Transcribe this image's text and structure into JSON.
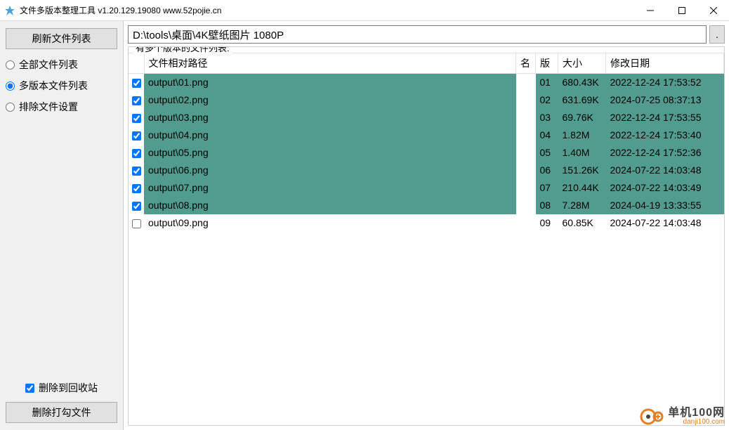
{
  "titlebar": {
    "title": "文件多版本整理工具 v1.20.129.19080 www.52pojie.cn"
  },
  "sidebar": {
    "refresh_label": "刷新文件列表",
    "radios": {
      "all_label": "全部文件列表",
      "multi_label": "多版本文件列表",
      "exclude_label": "排除文件设置"
    },
    "recycle_label": "删除到回收站",
    "delete_label": "删除打勾文件"
  },
  "main": {
    "path_value": "D:\\tools\\桌面\\4K壁纸图片 1080P",
    "path_btn": ".",
    "group_title": "有多个版本的文件列表:",
    "headers": {
      "path": "文件相对路径",
      "name": "名",
      "ver": "版",
      "size": "大小",
      "date": "修改日期"
    },
    "rows": [
      {
        "checked": true,
        "selected": true,
        "path": "output\\01.png",
        "name": "",
        "ver": "01",
        "size": "680.43K",
        "date": "2022-12-24 17:53:52"
      },
      {
        "checked": true,
        "selected": true,
        "path": "output\\02.png",
        "name": "",
        "ver": "02",
        "size": "631.69K",
        "date": "2024-07-25 08:37:13"
      },
      {
        "checked": true,
        "selected": true,
        "path": "output\\03.png",
        "name": "",
        "ver": "03",
        "size": "69.76K",
        "date": "2022-12-24 17:53:55"
      },
      {
        "checked": true,
        "selected": true,
        "path": "output\\04.png",
        "name": "",
        "ver": "04",
        "size": "1.82M",
        "date": "2022-12-24 17:53:40"
      },
      {
        "checked": true,
        "selected": true,
        "path": "output\\05.png",
        "name": "",
        "ver": "05",
        "size": "1.40M",
        "date": "2022-12-24 17:52:36"
      },
      {
        "checked": true,
        "selected": true,
        "path": "output\\06.png",
        "name": "",
        "ver": "06",
        "size": "151.26K",
        "date": "2024-07-22 14:03:48"
      },
      {
        "checked": true,
        "selected": true,
        "path": "output\\07.png",
        "name": "",
        "ver": "07",
        "size": "210.44K",
        "date": "2024-07-22 14:03:49"
      },
      {
        "checked": true,
        "selected": true,
        "path": "output\\08.png",
        "name": "",
        "ver": "08",
        "size": "7.28M",
        "date": "2024-04-19 13:33:55"
      },
      {
        "checked": false,
        "selected": false,
        "path": "output\\09.png",
        "name": "",
        "ver": "09",
        "size": "60.85K",
        "date": "2024-07-22 14:03:48"
      }
    ]
  },
  "watermark": {
    "main": "单机100网",
    "sub": "danji100.com"
  }
}
